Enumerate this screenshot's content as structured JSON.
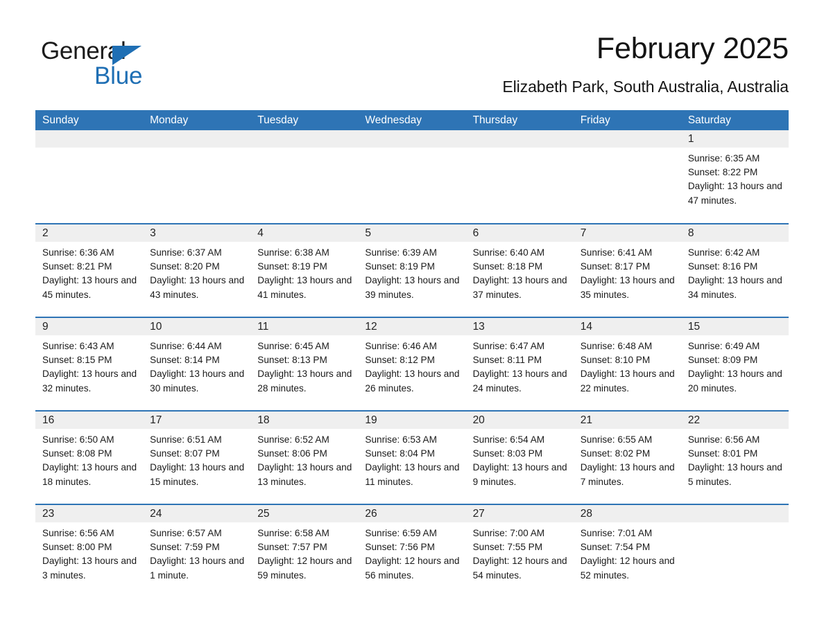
{
  "brand": {
    "name_part1": "General",
    "name_part2": "Blue",
    "triangle_color": "#1f6fb4",
    "logo_icon": "triangle-icon"
  },
  "header": {
    "month_title": "February 2025",
    "location": "Elizabeth Park, South Australia, Australia"
  },
  "theme": {
    "header_blue": "#2e74b5",
    "band_gray": "#efefef",
    "text": "#1a1a1a"
  },
  "calendar": {
    "weekday_headers": [
      "Sunday",
      "Monday",
      "Tuesday",
      "Wednesday",
      "Thursday",
      "Friday",
      "Saturday"
    ],
    "labels": {
      "sunrise": "Sunrise:",
      "sunset": "Sunset:",
      "daylight": "Daylight:"
    },
    "weeks": [
      [
        {
          "day": "",
          "empty": true
        },
        {
          "day": "",
          "empty": true
        },
        {
          "day": "",
          "empty": true
        },
        {
          "day": "",
          "empty": true
        },
        {
          "day": "",
          "empty": true
        },
        {
          "day": "",
          "empty": true
        },
        {
          "day": "1",
          "sunrise": "Sunrise: 6:35 AM",
          "sunset": "Sunset: 8:22 PM",
          "daylight": "Daylight: 13 hours and 47 minutes."
        }
      ],
      [
        {
          "day": "2",
          "sunrise": "Sunrise: 6:36 AM",
          "sunset": "Sunset: 8:21 PM",
          "daylight": "Daylight: 13 hours and 45 minutes."
        },
        {
          "day": "3",
          "sunrise": "Sunrise: 6:37 AM",
          "sunset": "Sunset: 8:20 PM",
          "daylight": "Daylight: 13 hours and 43 minutes."
        },
        {
          "day": "4",
          "sunrise": "Sunrise: 6:38 AM",
          "sunset": "Sunset: 8:19 PM",
          "daylight": "Daylight: 13 hours and 41 minutes."
        },
        {
          "day": "5",
          "sunrise": "Sunrise: 6:39 AM",
          "sunset": "Sunset: 8:19 PM",
          "daylight": "Daylight: 13 hours and 39 minutes."
        },
        {
          "day": "6",
          "sunrise": "Sunrise: 6:40 AM",
          "sunset": "Sunset: 8:18 PM",
          "daylight": "Daylight: 13 hours and 37 minutes."
        },
        {
          "day": "7",
          "sunrise": "Sunrise: 6:41 AM",
          "sunset": "Sunset: 8:17 PM",
          "daylight": "Daylight: 13 hours and 35 minutes."
        },
        {
          "day": "8",
          "sunrise": "Sunrise: 6:42 AM",
          "sunset": "Sunset: 8:16 PM",
          "daylight": "Daylight: 13 hours and 34 minutes."
        }
      ],
      [
        {
          "day": "9",
          "sunrise": "Sunrise: 6:43 AM",
          "sunset": "Sunset: 8:15 PM",
          "daylight": "Daylight: 13 hours and 32 minutes."
        },
        {
          "day": "10",
          "sunrise": "Sunrise: 6:44 AM",
          "sunset": "Sunset: 8:14 PM",
          "daylight": "Daylight: 13 hours and 30 minutes."
        },
        {
          "day": "11",
          "sunrise": "Sunrise: 6:45 AM",
          "sunset": "Sunset: 8:13 PM",
          "daylight": "Daylight: 13 hours and 28 minutes."
        },
        {
          "day": "12",
          "sunrise": "Sunrise: 6:46 AM",
          "sunset": "Sunset: 8:12 PM",
          "daylight": "Daylight: 13 hours and 26 minutes."
        },
        {
          "day": "13",
          "sunrise": "Sunrise: 6:47 AM",
          "sunset": "Sunset: 8:11 PM",
          "daylight": "Daylight: 13 hours and 24 minutes."
        },
        {
          "day": "14",
          "sunrise": "Sunrise: 6:48 AM",
          "sunset": "Sunset: 8:10 PM",
          "daylight": "Daylight: 13 hours and 22 minutes."
        },
        {
          "day": "15",
          "sunrise": "Sunrise: 6:49 AM",
          "sunset": "Sunset: 8:09 PM",
          "daylight": "Daylight: 13 hours and 20 minutes."
        }
      ],
      [
        {
          "day": "16",
          "sunrise": "Sunrise: 6:50 AM",
          "sunset": "Sunset: 8:08 PM",
          "daylight": "Daylight: 13 hours and 18 minutes."
        },
        {
          "day": "17",
          "sunrise": "Sunrise: 6:51 AM",
          "sunset": "Sunset: 8:07 PM",
          "daylight": "Daylight: 13 hours and 15 minutes."
        },
        {
          "day": "18",
          "sunrise": "Sunrise: 6:52 AM",
          "sunset": "Sunset: 8:06 PM",
          "daylight": "Daylight: 13 hours and 13 minutes."
        },
        {
          "day": "19",
          "sunrise": "Sunrise: 6:53 AM",
          "sunset": "Sunset: 8:04 PM",
          "daylight": "Daylight: 13 hours and 11 minutes."
        },
        {
          "day": "20",
          "sunrise": "Sunrise: 6:54 AM",
          "sunset": "Sunset: 8:03 PM",
          "daylight": "Daylight: 13 hours and 9 minutes."
        },
        {
          "day": "21",
          "sunrise": "Sunrise: 6:55 AM",
          "sunset": "Sunset: 8:02 PM",
          "daylight": "Daylight: 13 hours and 7 minutes."
        },
        {
          "day": "22",
          "sunrise": "Sunrise: 6:56 AM",
          "sunset": "Sunset: 8:01 PM",
          "daylight": "Daylight: 13 hours and 5 minutes."
        }
      ],
      [
        {
          "day": "23",
          "sunrise": "Sunrise: 6:56 AM",
          "sunset": "Sunset: 8:00 PM",
          "daylight": "Daylight: 13 hours and 3 minutes."
        },
        {
          "day": "24",
          "sunrise": "Sunrise: 6:57 AM",
          "sunset": "Sunset: 7:59 PM",
          "daylight": "Daylight: 13 hours and 1 minute."
        },
        {
          "day": "25",
          "sunrise": "Sunrise: 6:58 AM",
          "sunset": "Sunset: 7:57 PM",
          "daylight": "Daylight: 12 hours and 59 minutes."
        },
        {
          "day": "26",
          "sunrise": "Sunrise: 6:59 AM",
          "sunset": "Sunset: 7:56 PM",
          "daylight": "Daylight: 12 hours and 56 minutes."
        },
        {
          "day": "27",
          "sunrise": "Sunrise: 7:00 AM",
          "sunset": "Sunset: 7:55 PM",
          "daylight": "Daylight: 12 hours and 54 minutes."
        },
        {
          "day": "28",
          "sunrise": "Sunrise: 7:01 AM",
          "sunset": "Sunset: 7:54 PM",
          "daylight": "Daylight: 12 hours and 52 minutes."
        },
        {
          "day": "",
          "empty": true
        }
      ]
    ]
  }
}
